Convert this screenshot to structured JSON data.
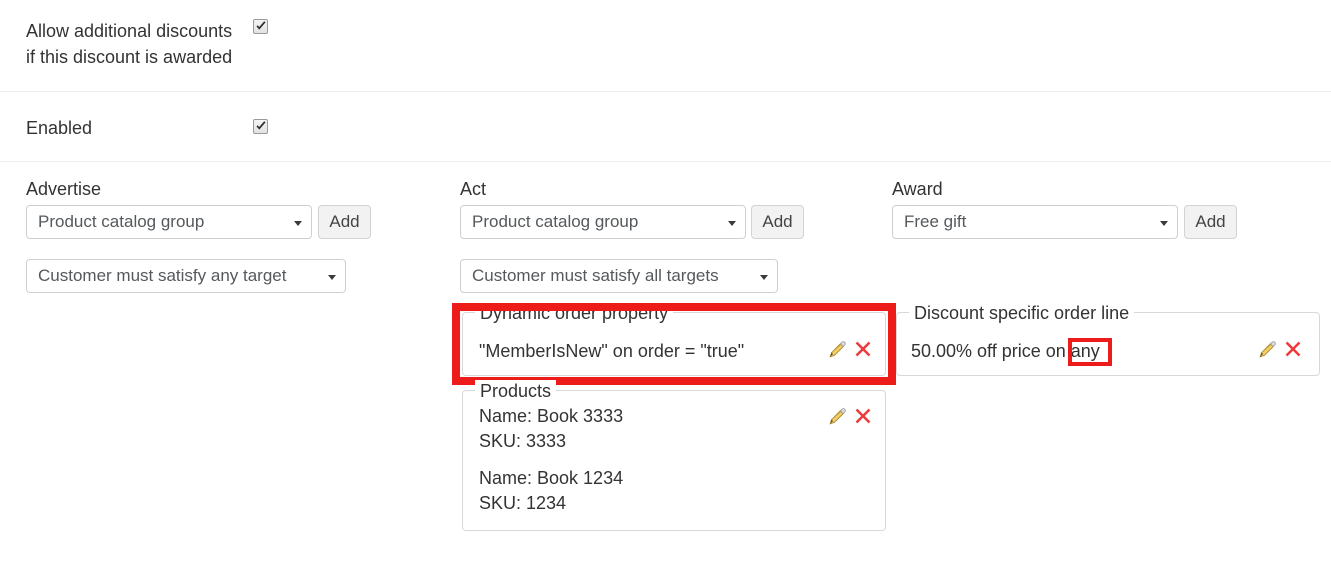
{
  "settings": {
    "allow_additional_label": "Allow additional discounts\nif this discount is awarded",
    "allow_additional_checked": true,
    "enabled_label": "Enabled",
    "enabled_checked": true
  },
  "columns": {
    "advertise": {
      "title": "Advertise",
      "type_select": "Product catalog group",
      "add_label": "Add",
      "target_select": "Customer must satisfy any target"
    },
    "act": {
      "title": "Act",
      "type_select": "Product catalog group",
      "add_label": "Add",
      "target_select": "Customer must satisfy all targets"
    },
    "award": {
      "title": "Award",
      "type_select": "Free gift",
      "add_label": "Add"
    }
  },
  "fieldsets": {
    "dynamic_order_property": {
      "legend": "Dynamic order property",
      "text": "\"MemberIsNew\" on order = \"true\""
    },
    "products": {
      "legend": "Products",
      "items": [
        {
          "name": "Name: Book 3333",
          "sku": "SKU: 3333"
        },
        {
          "name": "Name: Book 1234",
          "sku": "SKU: 1234"
        }
      ]
    },
    "discount_specific_order_line": {
      "legend": "Discount specific order line",
      "text_prefix": "50.00% off price on ",
      "highlighted_term": "any"
    }
  },
  "icons": {
    "edit": "pencil-icon",
    "delete": "red-x-icon",
    "dropdown": "caret-down-icon",
    "checked": "checkmark-icon"
  },
  "annotations": {
    "accent_color": "#ee1b1b"
  }
}
